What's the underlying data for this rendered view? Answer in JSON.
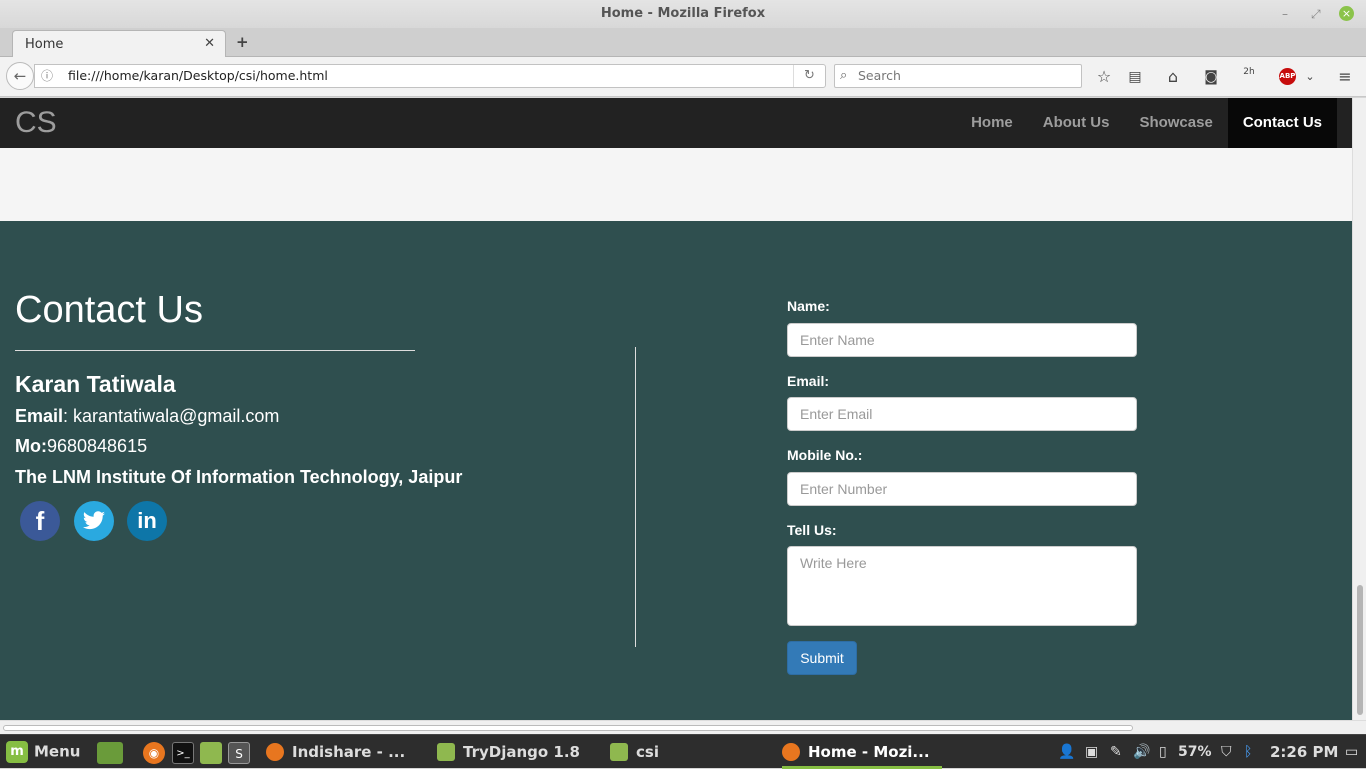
{
  "window": {
    "title": "Home - Mozilla Firefox"
  },
  "tab": {
    "label": "Home"
  },
  "browser": {
    "url": "file:///home/karan/Desktop/csi/home.html",
    "search_placeholder": "Search",
    "badge_text": "2h",
    "abp_label": "ABP"
  },
  "site": {
    "brand": "CS",
    "nav": [
      {
        "label": "Home"
      },
      {
        "label": "About Us"
      },
      {
        "label": "Showcase"
      },
      {
        "label": "Contact Us",
        "active": true
      }
    ],
    "contact": {
      "title": "Contact Us",
      "name": "Karan Tatiwala",
      "email_label": "Email",
      "email_value": ": karantatiwala@gmail.com",
      "mobile_label": "Mo:",
      "mobile_value": "9680848615",
      "institute": "The LNM Institute Of Information Technology, Jaipur",
      "social": [
        {
          "icon": "facebook-icon",
          "glyph": "f"
        },
        {
          "icon": "twitter-icon",
          "glyph": "🐦"
        },
        {
          "icon": "linkedin-icon",
          "glyph": "in"
        }
      ]
    },
    "form": {
      "name_label": "Name:",
      "name_placeholder": "Enter Name",
      "email_label": "Email:",
      "email_placeholder": "Enter Email",
      "mobile_label": "Mobile No.:",
      "mobile_placeholder": "Enter Number",
      "tell_label": "Tell Us:",
      "tell_placeholder": "Write Here",
      "submit_label": "Submit"
    }
  },
  "taskbar": {
    "menu_label": "Menu",
    "windows": [
      {
        "label": "Indishare - ..."
      },
      {
        "label": "TryDjango 1.8"
      },
      {
        "label": "csi"
      },
      {
        "label": "Home - Mozi...",
        "active": true
      }
    ],
    "battery": "57%",
    "clock": "2:26 PM"
  },
  "colors": {
    "footer_bg": "#2f4f4f",
    "nav_bg": "#222222",
    "submit_bg": "#337ab7",
    "taskbar_accent": "#86be43"
  }
}
